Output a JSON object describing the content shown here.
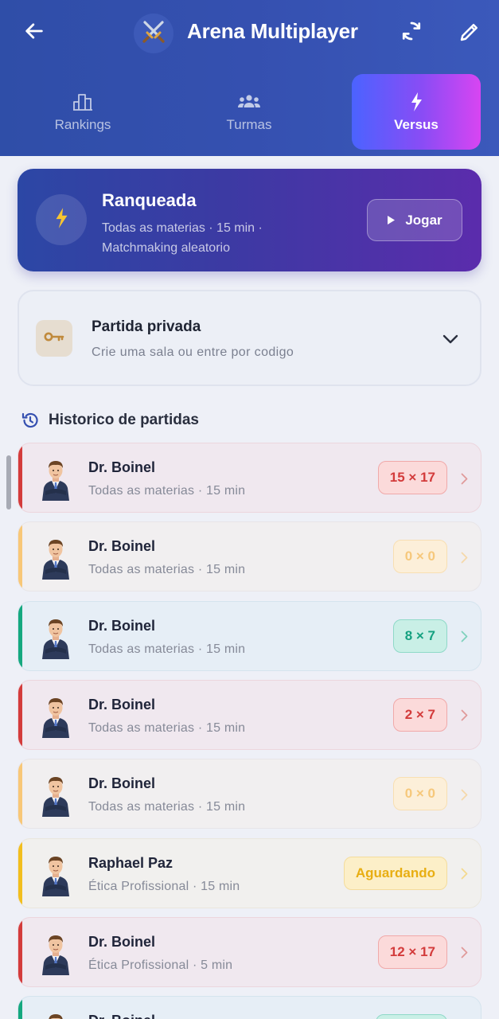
{
  "header": {
    "title": "Arena Multiplayer",
    "back_icon": "arrow-left-icon",
    "logo_icon": "crossed-swords-icon",
    "sync_icon": "sync-icon",
    "edit_icon": "pencil-icon",
    "accent": "#3550b0"
  },
  "tabs": [
    {
      "label": "Rankings",
      "icon": "bar-chart-icon",
      "active": false
    },
    {
      "label": "Turmas",
      "icon": "group-icon",
      "active": false
    },
    {
      "label": "Versus",
      "icon": "lightning-icon",
      "active": true
    }
  ],
  "ranked": {
    "title": "Ranqueada",
    "subtitle_line1": "Todas as materias · 15 min ·",
    "subtitle_line2": "Matchmaking aleatorio",
    "play_label": "Jogar",
    "icon": "lightning-icon"
  },
  "private_match": {
    "title": "Partida privada",
    "subtitle": "Crie uma sala ou entre por codigo",
    "icon": "key-icon"
  },
  "history": {
    "title": "Historico de partidas",
    "icon": "history-icon",
    "matches": [
      {
        "name": "Dr. Boinel",
        "meta": "Todas as materias · 15 min",
        "score": "15 × 17",
        "result": "loss"
      },
      {
        "name": "Dr. Boinel",
        "meta": "Todas as materias · 15 min",
        "score": "0 × 0",
        "result": "draw"
      },
      {
        "name": "Dr. Boinel",
        "meta": "Todas as materias · 15 min",
        "score": "8 × 7",
        "result": "win"
      },
      {
        "name": "Dr. Boinel",
        "meta": "Todas as materias · 15 min",
        "score": "2 × 7",
        "result": "loss"
      },
      {
        "name": "Dr. Boinel",
        "meta": "Todas as materias · 15 min",
        "score": "0 × 0",
        "result": "draw"
      },
      {
        "name": "Raphael Paz",
        "meta": "Ética Profissional · 15 min",
        "score": "Aguardando",
        "result": "waiting"
      },
      {
        "name": "Dr. Boinel",
        "meta": "Ética Profissional · 5 min",
        "score": "12 × 17",
        "result": "loss"
      },
      {
        "name": "Dr. Boinel",
        "meta": "",
        "score": "",
        "result": "win"
      }
    ]
  },
  "colors": {
    "loss": "#d33b3b",
    "draw": "#f6c87b",
    "win": "#15a180",
    "waiting": "#e8ae12"
  }
}
